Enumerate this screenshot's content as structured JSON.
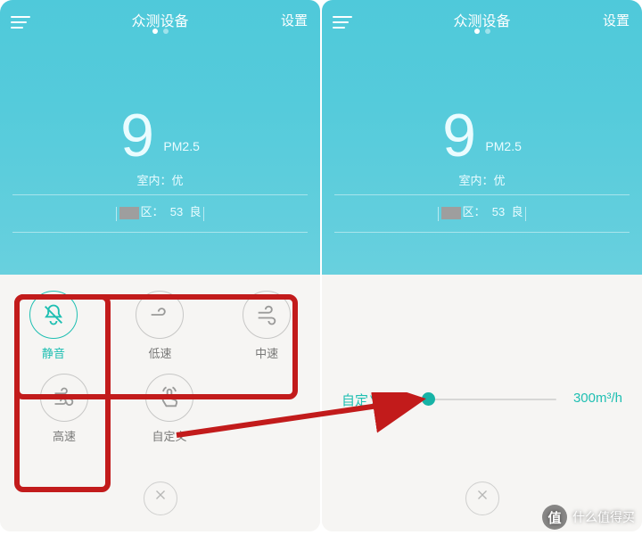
{
  "header": {
    "title": "众测设备",
    "settings": "设置"
  },
  "reading": {
    "value": "9",
    "unit": "PM2.5",
    "indoor_label": "室内：",
    "indoor_quality": "优",
    "outdoor_area_suffix": "区：",
    "outdoor_value": "53",
    "outdoor_quality": "良"
  },
  "modes": {
    "silent": "静音",
    "low": "低速",
    "medium": "中速",
    "high": "高速",
    "custom": "自定义"
  },
  "slider": {
    "label": "自定义风速",
    "value": "300m³/h"
  },
  "watermark": {
    "badge": "值",
    "text": "什么值得买"
  }
}
